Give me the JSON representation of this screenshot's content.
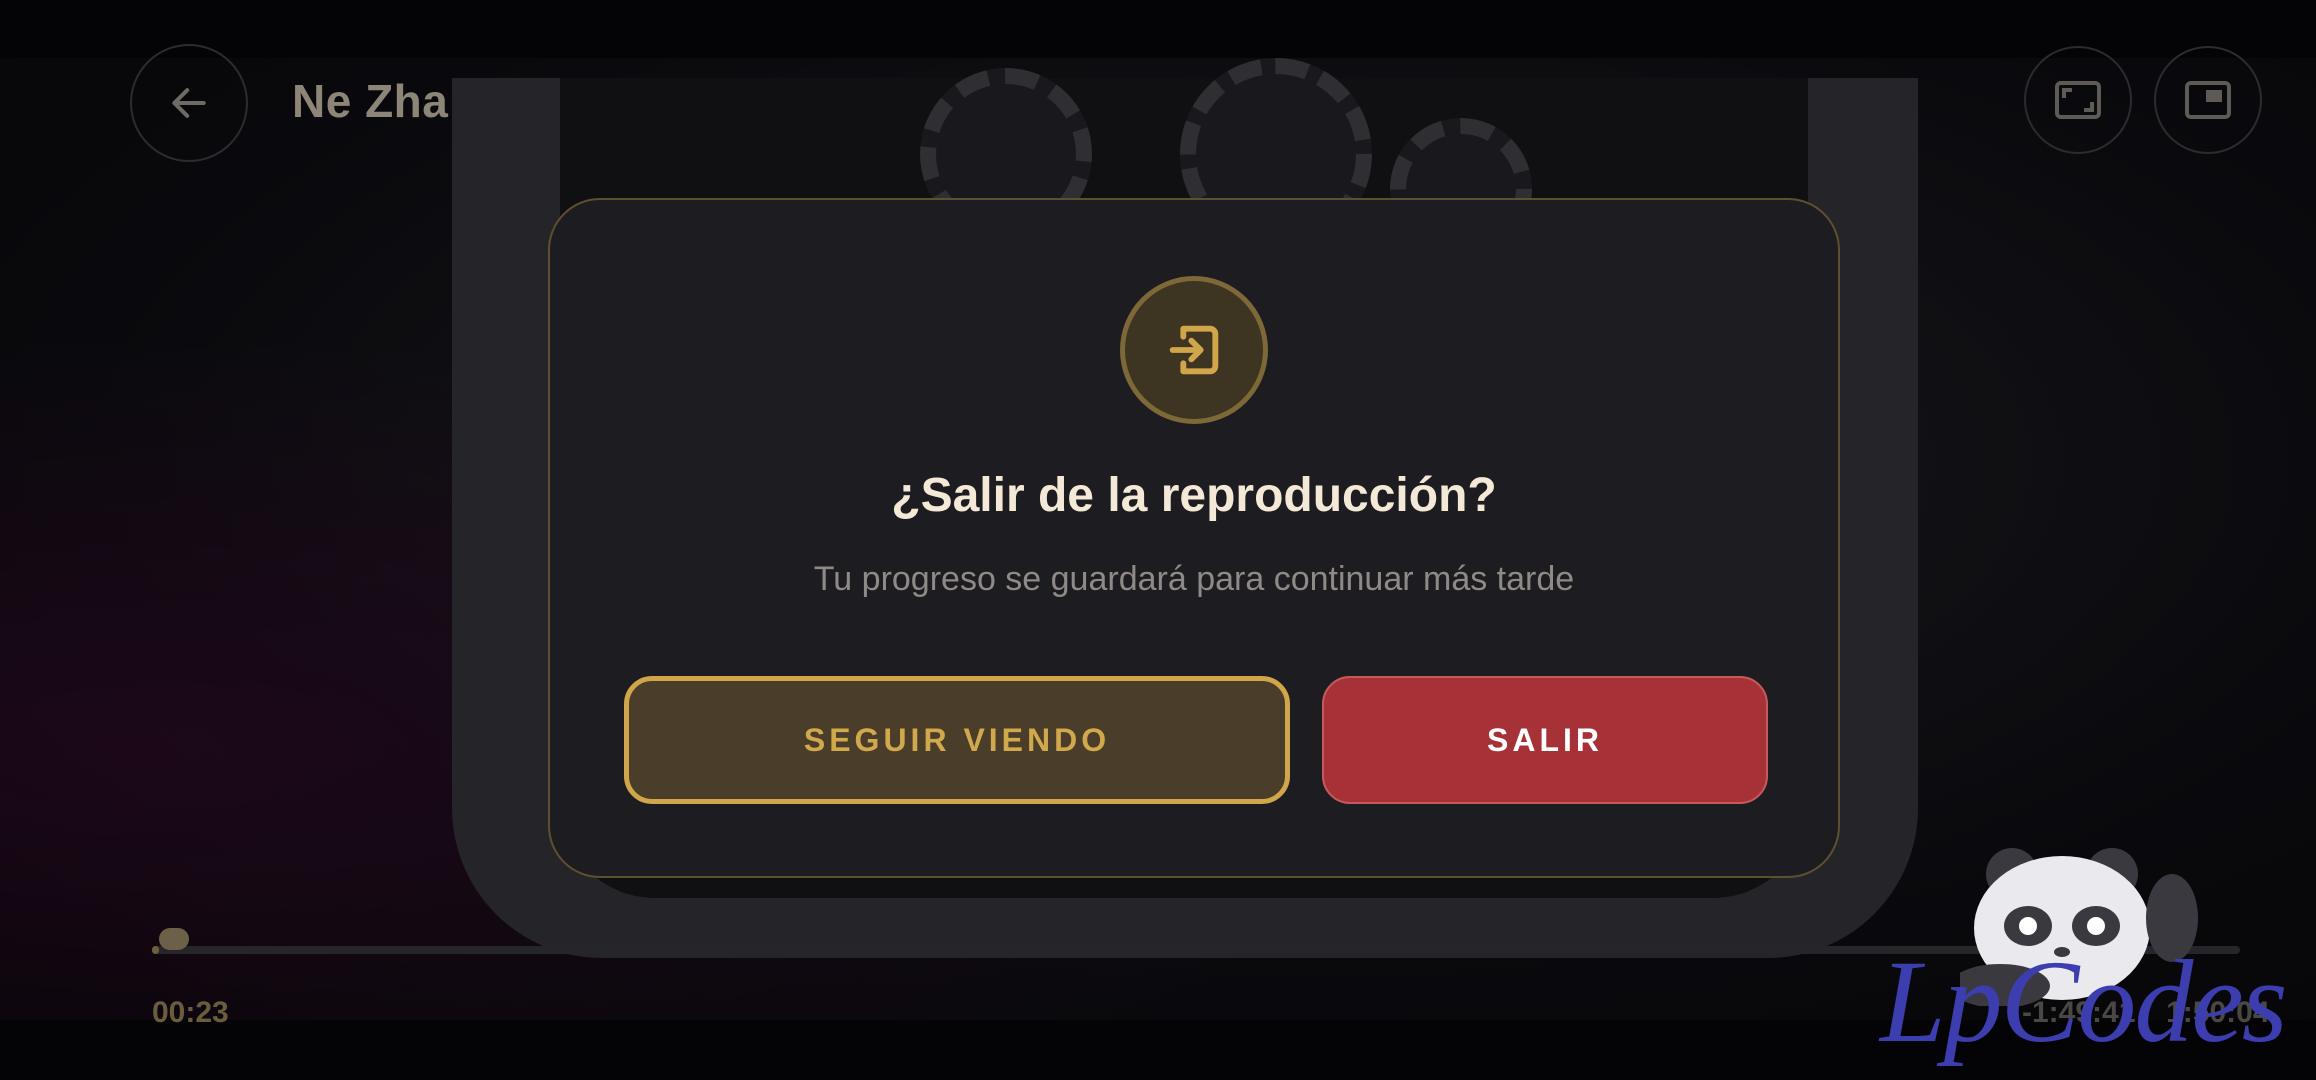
{
  "player": {
    "title": "Ne Zha",
    "time_current": "00:23",
    "time_remaining": "-1:49:41",
    "time_total": "1:50:04",
    "progress_fraction": 0.0035
  },
  "dialog": {
    "title": "¿Salir de la reproducción?",
    "subtitle": "Tu progreso se guardará para continuar más tarde",
    "continue_label": "SEGUIR VIENDO",
    "exit_label": "SALIR",
    "icon": "exit-arrow-icon"
  },
  "watermark": {
    "text": "LpCodes"
  },
  "colors": {
    "accent_gold": "#d1a64b",
    "exit_red": "#a63237",
    "dialog_bg": "#1c1c21",
    "title_text": "#f3e9d6"
  }
}
